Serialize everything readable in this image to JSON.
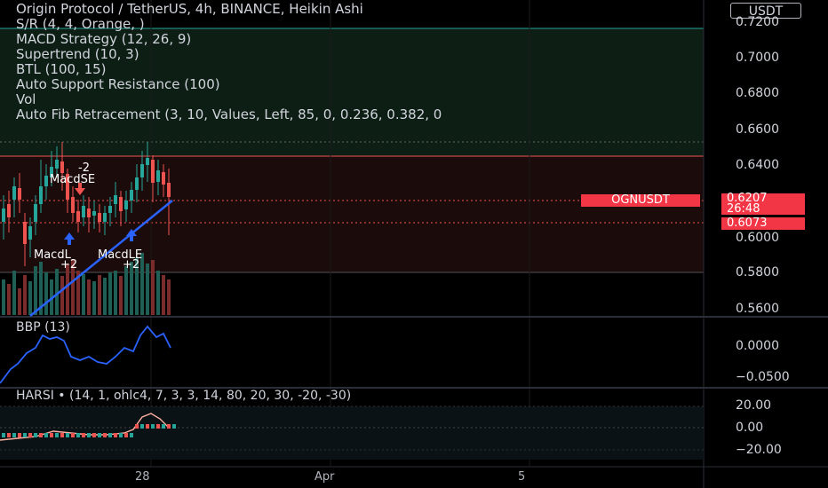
{
  "legend": {
    "title": "Origin Protocol / TetherUS, 4h, BINANCE, Heikin Ashi",
    "indicators": [
      "S/R (4, 4, Orange, )",
      "MACD Strategy (12, 26, 9)",
      "Supertrend (10, 3)",
      "BTL (100, 15)",
      "Auto Support Resistance (100)",
      "Vol",
      "Auto Fib Retracement (3, 10, Values, Left, 85, 0, 0.236, 0.382, 0"
    ]
  },
  "currency": "USDT",
  "price_axis": [
    "0.7200",
    "0.7000",
    "0.6800",
    "0.6600",
    "0.6400",
    "0.6200",
    "0.6000",
    "0.5800",
    "0.5600"
  ],
  "price_tag": {
    "value": "0.6207",
    "countdown": "26:48",
    "symbol": "OGNUSDT",
    "second": "0.6073"
  },
  "signals": {
    "short_count": "-2",
    "short_label": "MacdSE",
    "long1_label": "MacdL",
    "long1_count": "+2",
    "long2_label": "MacdLE",
    "long2_count": "+2"
  },
  "bbp": {
    "label": "BBP (13)",
    "axis": [
      "0.0000",
      "−0.0500"
    ]
  },
  "harsi": {
    "label": "HARSI • (14, 1, ohlc4, 7, 3, 3, 14, 80, 20, 30, -20, -30)",
    "axis": [
      "20.00",
      "0.00",
      "−20.00"
    ]
  },
  "time_axis": [
    "28",
    "Apr",
    "5"
  ],
  "colors": {
    "up": "#26a69a",
    "down": "#ef5350",
    "trend": "#2962ff",
    "tag": "#f23645"
  }
}
